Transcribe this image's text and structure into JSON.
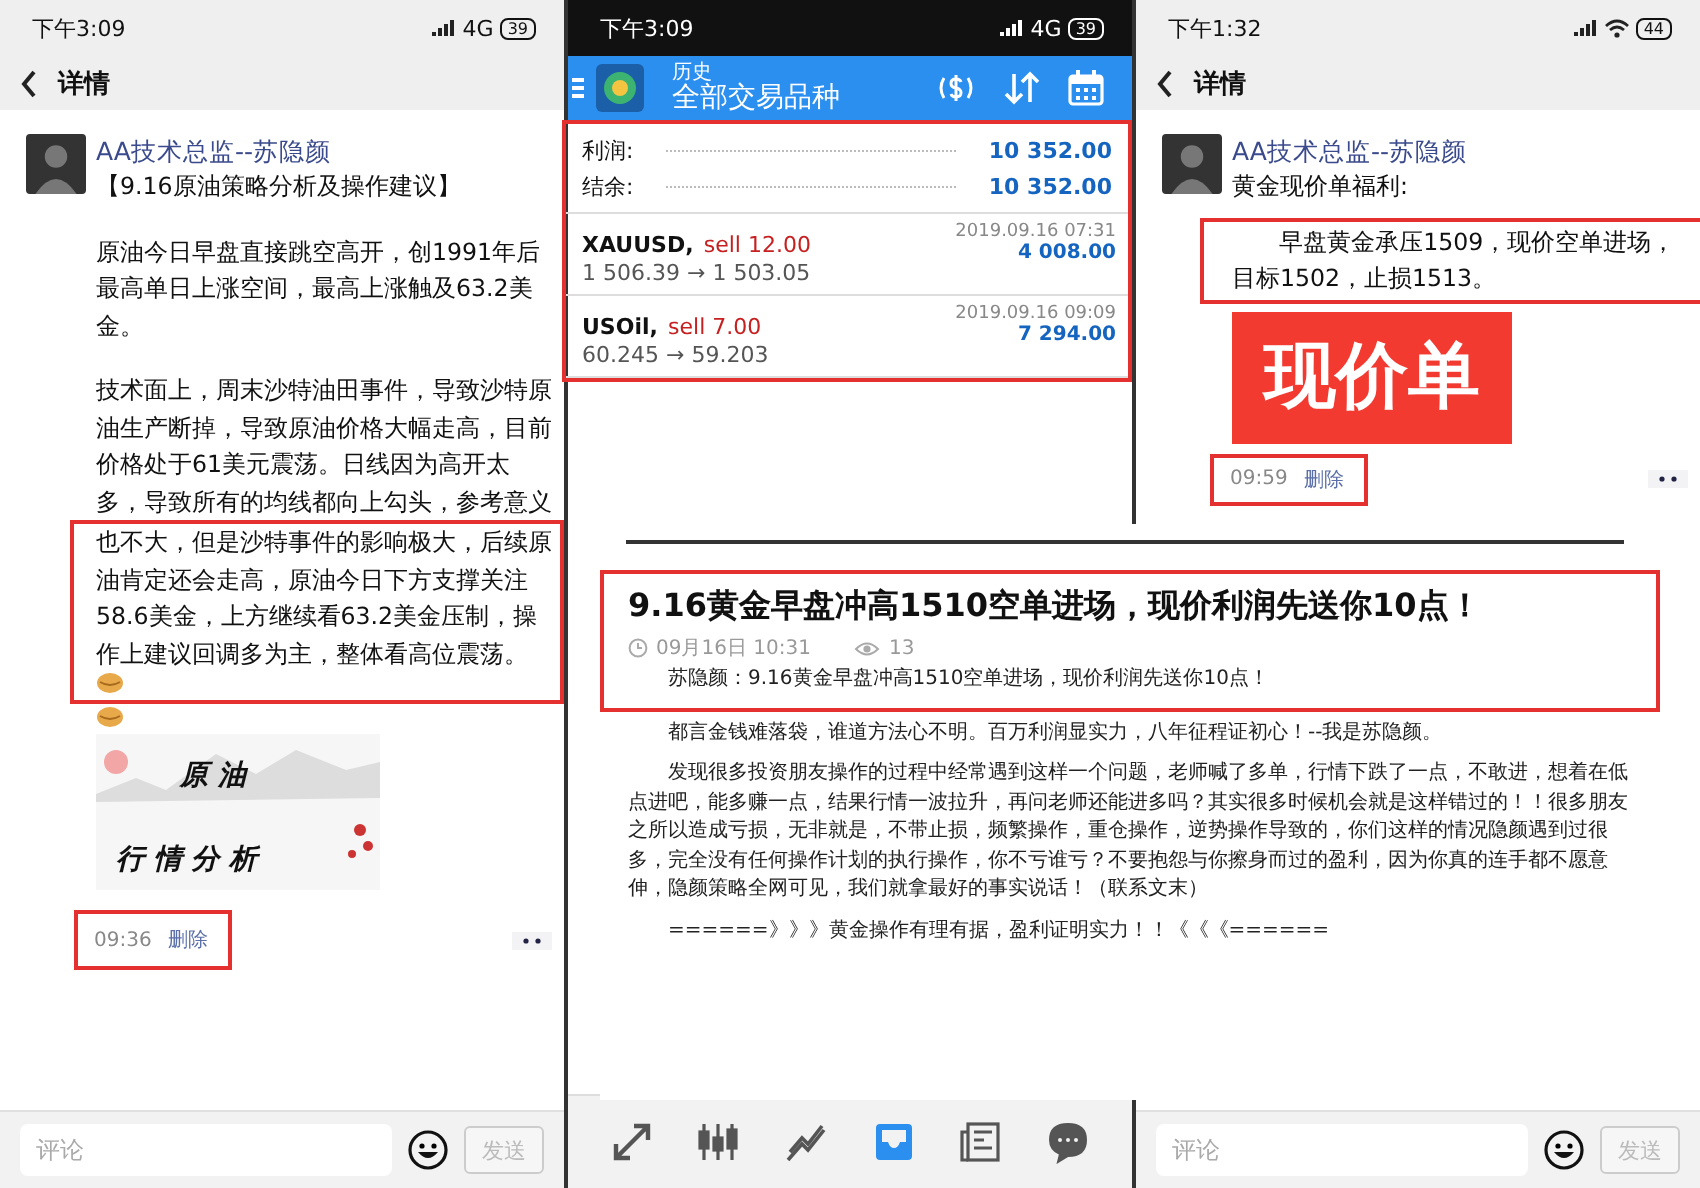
{
  "left_screen": {
    "status_bar": {
      "time": "下午3:09",
      "network": "4G",
      "battery": "39"
    },
    "header": {
      "title": "详情"
    },
    "post": {
      "author": "AA技术总监--苏隐颜",
      "title": "【9.16原油策略分析及操作建议】",
      "paragraphs": [
        "原油今日早盘直接跳空高开，创1991年后最高单日上涨空间，最高上涨触及63.2美金。",
        "技术面上，周末沙特油田事件，导致沙特原油生产断掉，导致原油价格大幅走高，目前价格处于61美元震荡。日线因为高开太多，导致所有的均线都向上勾头，参考意义"
      ],
      "highlighted_text": "也不大，但是沙特事件的影响极大，后续原油肯定还会走高，原油今日下方支撑关注58.6美金，上方继续看63.2美金压制，操作上建议回调多为主，整体看高位震荡。",
      "banner_lines": [
        "原 油",
        "行 情 分 析"
      ],
      "time": "09:36",
      "delete": "删除"
    },
    "comment_bar": {
      "placeholder": "评论",
      "send": "发送",
      "send_disabled": true
    }
  },
  "middle_screen": {
    "status_bar": {
      "time": "下午3:09",
      "network": "4G",
      "battery": "39"
    },
    "app_bar": {
      "subtitle": "历史",
      "title": "全部交易品种"
    },
    "summary": [
      {
        "label": "利润:",
        "value": "10 352.00"
      },
      {
        "label": "结余:",
        "value": "10 352.00"
      }
    ],
    "trades": [
      {
        "symbol": "XAUUSD,",
        "side": "sell 12.00",
        "prices": "1 506.39 → 1 503.05",
        "date": "2019.09.16 07:31",
        "profit": "4 008.00"
      },
      {
        "symbol": "USOil,",
        "side": "sell 7.00",
        "prices": "60.245 → 59.203",
        "date": "2019.09.16 09:09",
        "profit": "7 294.00"
      }
    ],
    "nav": [
      {
        "selected": false
      },
      {
        "selected": false
      },
      {
        "selected": false
      },
      {
        "selected": true
      },
      {
        "selected": false
      },
      {
        "selected": false
      }
    ]
  },
  "right_screen": {
    "status_bar": {
      "time": "下午1:32",
      "battery": "44"
    },
    "header": {
      "title": "详情"
    },
    "post": {
      "author": "AA技术总监--苏隐颜",
      "title": "黄金现价单福利:",
      "paragraph": "早盘黄金承压1509，现价空单进场，目标1502，止损1513。",
      "banner": "现价单",
      "time": "09:59",
      "delete": "删除"
    },
    "comment_bar": {
      "placeholder": "评论",
      "send": "发送",
      "send_disabled": true
    }
  },
  "article": {
    "title": "9.16黄金早盘冲高1510空单进场，现价利润先送你10点！",
    "date": "09月16日 10:31",
    "views": "13",
    "lead": "苏隐颜：9.16黄金早盘冲高1510空单进场，现价利润先送你10点！",
    "paragraphs": [
      "都言金钱难落袋，谁道方法心不明。百万利润显实力，八年征程证初心！--我是苏隐颜。",
      "发现很多投资朋友操作的过程中经常遇到这样一个问题，老师喊了多单，行情下跌了一点，不敢进，想着在低点进吧，能多赚一点，结果行情一波拉升，再问老师还能进多吗？其实很多时候机会就是这样错过的！！很多朋友之所以造成亏损，无非就是，不带止损，频繁操作，重仓操作，逆势操作导致的，你们这样的情况隐颜遇到过很多，完全没有任何操作计划的执行操作，你不亏谁亏？不要抱怨与你擦身而过的盈利，因为你真的连手都不愿意伸，隐颜策略全网可见，我们就拿最好的事实说话！（联系文末）",
      "======》》》黄金操作有理有据，盈利证明实力！！《《《======"
    ]
  }
}
